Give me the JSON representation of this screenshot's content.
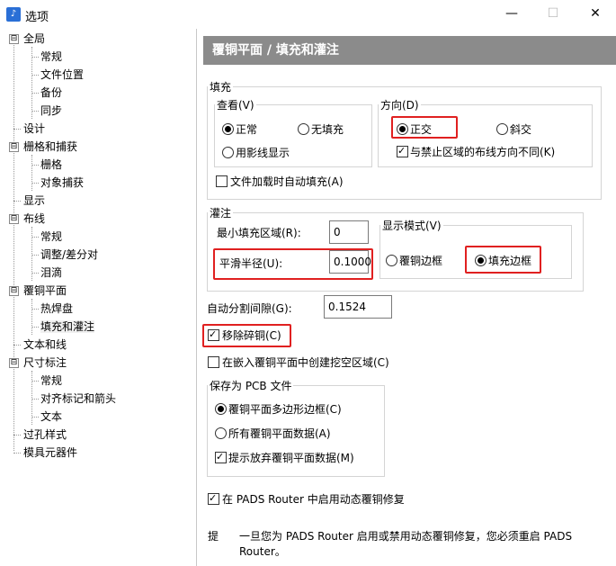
{
  "window": {
    "title": "选项",
    "app_icon": "options-app-icon",
    "min_icon": "—",
    "max_icon": "☐",
    "close_icon": "✕"
  },
  "tree": {
    "items": [
      {
        "label": "全局",
        "expander": "⊟"
      },
      {
        "label": "常规"
      },
      {
        "label": "文件位置"
      },
      {
        "label": "备份"
      },
      {
        "label": "同步"
      },
      {
        "label": "设计"
      },
      {
        "label": "栅格和捕获",
        "expander": "⊟"
      },
      {
        "label": "栅格"
      },
      {
        "label": "对象捕获"
      },
      {
        "label": "显示"
      },
      {
        "label": "布线",
        "expander": "⊟"
      },
      {
        "label": "常规"
      },
      {
        "label": "调整/差分对"
      },
      {
        "label": "泪滴"
      },
      {
        "label": "覆铜平面",
        "expander": "⊟"
      },
      {
        "label": "热焊盘"
      },
      {
        "label": "填充和灌注"
      },
      {
        "label": "文本和线"
      },
      {
        "label": "尺寸标注",
        "expander": "⊟"
      },
      {
        "label": "常规"
      },
      {
        "label": "对齐标记和箭头"
      },
      {
        "label": "文本"
      },
      {
        "label": "过孔样式"
      },
      {
        "label": "模具元器件"
      }
    ]
  },
  "panel": {
    "header": "覆铜平面 / 填充和灌注",
    "fill": {
      "legend": "填充",
      "view": {
        "legend": "查看(V)",
        "normal": "正常",
        "no_fill": "无填充",
        "hatch": "用影线显示"
      },
      "direction": {
        "legend": "方向(D)",
        "orthogonal": "正交",
        "diagonal": "斜交",
        "differ": "与禁止区域的布线方向不同(K)"
      },
      "auto_fill": "文件加载时自动填充(A)"
    },
    "flood": {
      "legend": "灌注",
      "min_area_label": "最小填充区域(R):",
      "min_area_value": "0",
      "smooth_label": "平滑半径(U):",
      "smooth_value": "0.1000",
      "display": {
        "legend": "显示模式(V)",
        "copper_outline": "覆铜边框",
        "fill_outline": "填充边框"
      }
    },
    "auto_split_label": "自动分割间隙(G):",
    "auto_split_value": "0.1524",
    "remove_slivers": "移除碎铜(C)",
    "create_cutout": "在嵌入覆铜平面中创建挖空区域(C)",
    "save_as": {
      "legend": "保存为 PCB 文件",
      "poly_outline": "覆铜平面多边形边框(C)",
      "all_data": "所有覆铜平面数据(A)",
      "prompt_discard": "提示放弃覆铜平面数据(M)"
    },
    "dynamic_repair": "在 PADS Router 中启用动态覆铜修复",
    "tip_label": "提",
    "tip_text_1": "一旦您为 PADS Router 启用或禁用动态覆铜修复，您必须重启 PADS",
    "tip_text_2": "Router。"
  }
}
